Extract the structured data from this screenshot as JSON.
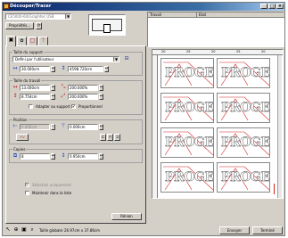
{
  "window": {
    "title": "Découper/Tracer",
    "min": "_",
    "max": "□",
    "close": "×"
  },
  "device": {
    "combo_value": "CE5000-60(Graphtec USB",
    "properties_button": "Propriétés..."
  },
  "job_list": {
    "columns": [
      "Travail",
      "Etat"
    ]
  },
  "tabs": [
    {
      "icon": "page-icon"
    },
    {
      "icon": "weed-icon"
    },
    {
      "icon": "frame-icon"
    },
    {
      "icon": "blade-icon"
    }
  ],
  "support": {
    "title": "Taille du support",
    "preset": "Defini par l'utilisateur",
    "width": "30.000cm",
    "length": "4598.720cm"
  },
  "work": {
    "title": "Taille du travail",
    "width": "13.000cm",
    "height": "8.754cm",
    "scale_x": "200.000%",
    "scale_y": "200.000%",
    "fit_label": "Adapter au support",
    "proportional_label": "Proportionnel",
    "fit_checked": "",
    "proportional_checked": "✔"
  },
  "position": {
    "title": "Position",
    "x": "0.000cm",
    "y": "0.000cm"
  },
  "copies": {
    "title": "Copies",
    "count": "8",
    "spacing": "0.954cm"
  },
  "options": {
    "selection_only": "Sélection uniquement",
    "keep_on_top": "Maintenir dans la liste"
  },
  "buttons": {
    "reset": "Rénion",
    "send": "Envoyer",
    "done": "Terminé"
  },
  "status": {
    "global_size_label": "Taille globale:",
    "global_size_value": "26.97cm x 37.86cm"
  },
  "ruler": {
    "ticks": [
      "20",
      "25",
      "20",
      "25",
      "20"
    ]
  },
  "sticker_text": "PROGETTI",
  "colors": {
    "titlebar": "#0a246a",
    "accent_red": "#d02020",
    "window_bg": "#d4d0c8"
  }
}
